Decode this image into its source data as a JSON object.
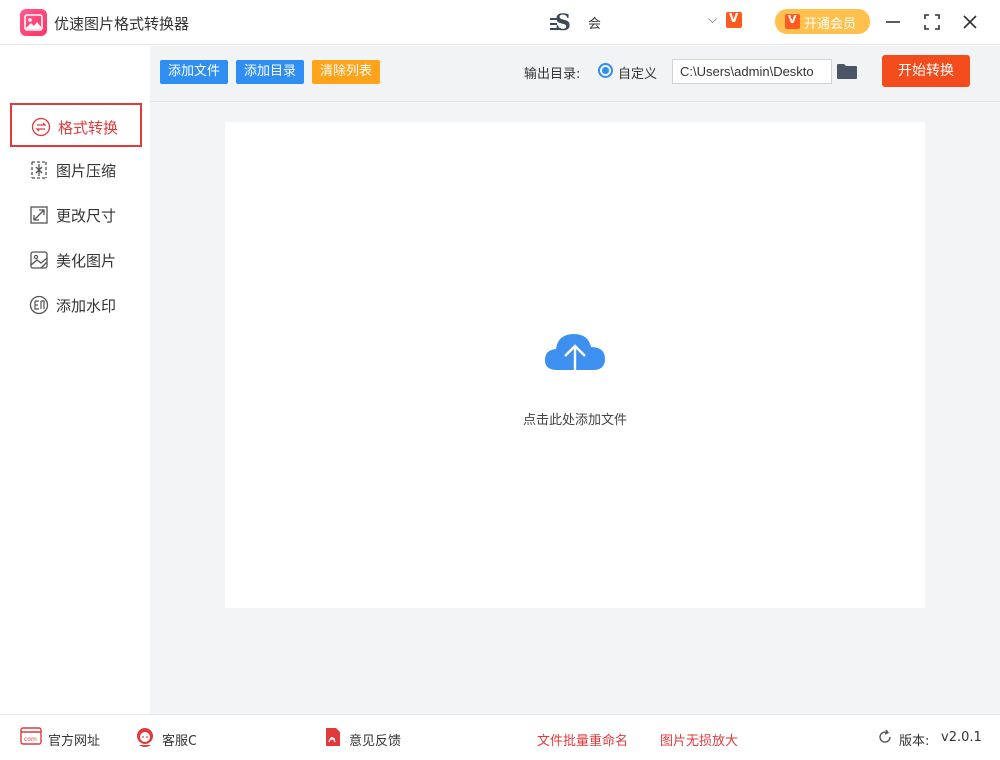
{
  "titlebar": {
    "app_title": "优速图片格式转换器",
    "user_name": "会",
    "vip_label": "开通会员",
    "vip_badge": "V"
  },
  "sidebar": {
    "items": [
      {
        "label": "格式转换",
        "icon": "convert-icon",
        "active": true
      },
      {
        "label": "图片压缩",
        "icon": "compress-icon",
        "active": false
      },
      {
        "label": "更改尺寸",
        "icon": "resize-icon",
        "active": false
      },
      {
        "label": "美化图片",
        "icon": "beautify-icon",
        "active": false
      },
      {
        "label": "添加水印",
        "icon": "watermark-icon",
        "active": false
      }
    ]
  },
  "toolbar": {
    "add_file": "添加文件",
    "add_folder": "添加目录",
    "clear_list": "清除列表",
    "output_label": "输出目录:",
    "custom_label": "自定义",
    "output_path": "C:\\Users\\admin\\Deskto",
    "start_label": "开始转换"
  },
  "main": {
    "drop_text": "点击此处添加文件"
  },
  "footer": {
    "website": "官方网址",
    "service": "客服C",
    "feedback": "意见反馈",
    "batch_rename": "文件批量重命名",
    "upscale": "图片无损放大",
    "version_label": "版本:",
    "version_value": "v2.0.1"
  },
  "colors": {
    "accent_blue": "#2f8ef2",
    "accent_orange": "#ffa31a",
    "start_red": "#f24b1c",
    "active_red": "#e03a3a",
    "vip_gold": "#ffc04d"
  }
}
